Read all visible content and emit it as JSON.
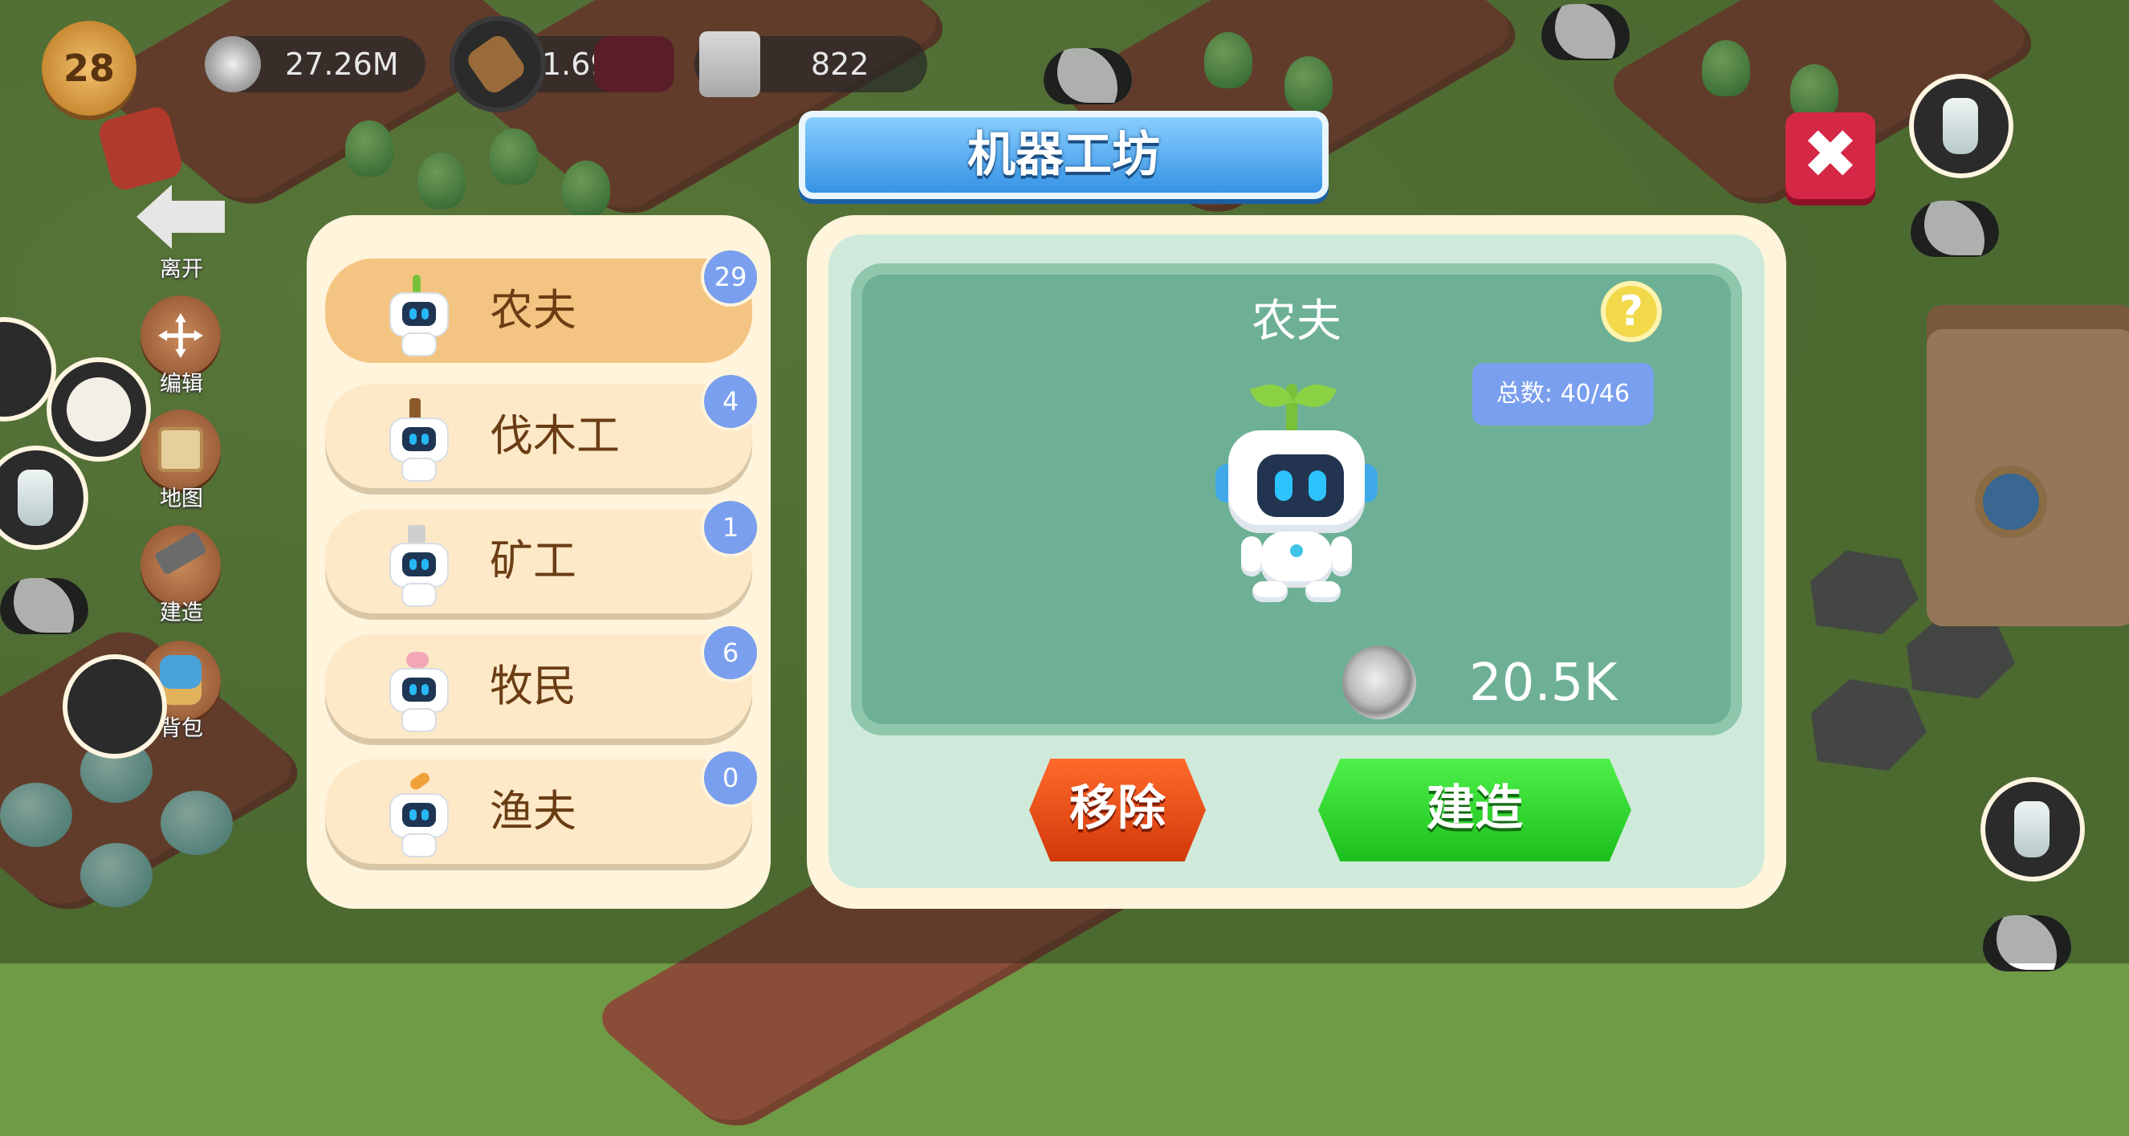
{
  "hud": {
    "level": "28",
    "silver": "27.26M",
    "wood": "1.691K",
    "stone": "822"
  },
  "side_menu": {
    "leave": "离开",
    "edit": "编辑",
    "map": "地图",
    "build": "建造",
    "backpack": "背包"
  },
  "window": {
    "title": "机器工坊"
  },
  "robot_list": [
    {
      "name": "农夫",
      "count": "29",
      "accessory": "sprout"
    },
    {
      "name": "伐木工",
      "count": "4",
      "accessory": "log"
    },
    {
      "name": "矿工",
      "count": "1",
      "accessory": "stone"
    },
    {
      "name": "牧民",
      "count": "6",
      "accessory": "pig"
    },
    {
      "name": "渔夫",
      "count": "0",
      "accessory": "fish"
    }
  ],
  "detail": {
    "name": "农夫",
    "help": "?",
    "total_label": "总数:",
    "total_value": "40/46",
    "price": "20.5K"
  },
  "buttons": {
    "remove": "移除",
    "build": "建造",
    "close": "✖"
  },
  "colors": {
    "accent_blue": "#2f8ee3",
    "selected_item": "#f4c582",
    "badge_blue": "#7a9fee",
    "remove_orange": "#d2380b",
    "build_green": "#1bbf1b",
    "close_red": "#d52746"
  }
}
